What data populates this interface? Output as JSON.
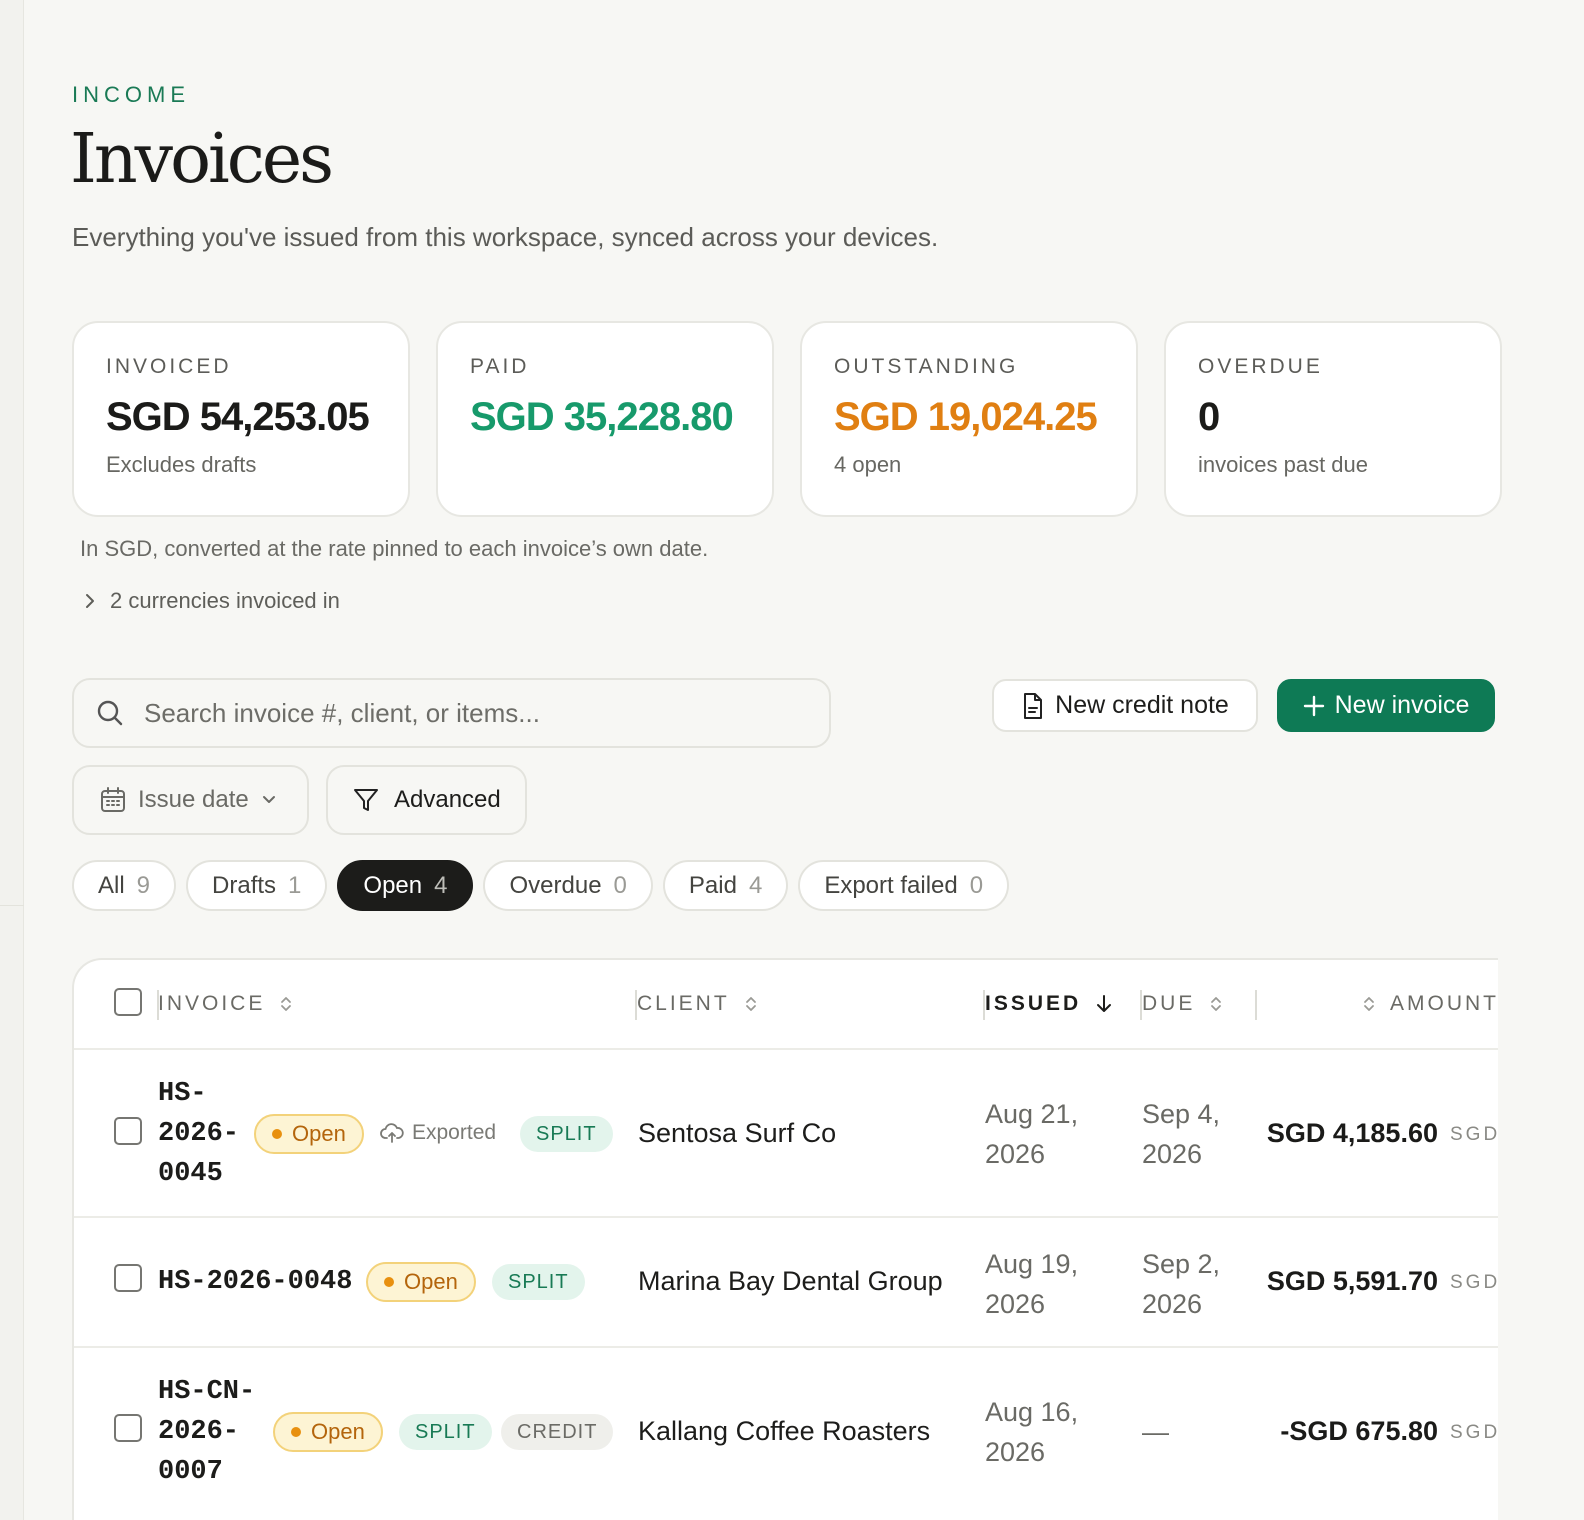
{
  "header": {
    "eyebrow": "INCOME",
    "title": "Invoices",
    "subtitle": "Everything you've issued from this workspace, synced across your devices."
  },
  "stats": [
    {
      "label": "INVOICED",
      "value": "SGD 54,253.05",
      "note": "Excludes drafts",
      "color": "#1b1b19"
    },
    {
      "label": "PAID",
      "value": "SGD 35,228.80",
      "note": "",
      "color": "#179a6b"
    },
    {
      "label": "OUTSTANDING",
      "value": "SGD 19,024.25",
      "note": "4 open",
      "color": "#e07f12"
    },
    {
      "label": "OVERDUE",
      "value": "0",
      "note": "invoices past due",
      "color": "#1b1b19"
    }
  ],
  "conversion_note": "In SGD, converted at the rate pinned to each invoice’s own date.",
  "currencies_toggle": "2 currencies invoiced in",
  "search": {
    "placeholder": "Search invoice #, client, or items..."
  },
  "actions": {
    "new_credit_note": "New credit note",
    "new_invoice": "New invoice"
  },
  "filters": {
    "issue_date": "Issue date",
    "advanced": "Advanced"
  },
  "chips": [
    {
      "label": "All",
      "count": "9",
      "active": false
    },
    {
      "label": "Drafts",
      "count": "1",
      "active": false
    },
    {
      "label": "Open",
      "count": "4",
      "active": true
    },
    {
      "label": "Overdue",
      "count": "0",
      "active": false
    },
    {
      "label": "Paid",
      "count": "4",
      "active": false
    },
    {
      "label": "Export failed",
      "count": "0",
      "active": false
    }
  ],
  "table": {
    "columns": {
      "invoice": "INVOICE",
      "client": "CLIENT",
      "issued": "ISSUED",
      "due": "DUE",
      "amount": "AMOUNT"
    },
    "rows": [
      {
        "number_lines": [
          "HS-",
          "2026-",
          "0045"
        ],
        "status": "Open",
        "exported": "Exported",
        "tags": [
          "SPLIT"
        ],
        "client": "Sentosa Surf Co",
        "issued_lines": [
          "Aug 21,",
          "2026"
        ],
        "due_lines": [
          "Sep 4,",
          "2026"
        ],
        "amount": "SGD 4,185.60",
        "currency": "SGD"
      },
      {
        "number_lines": [
          "HS-2026-0048"
        ],
        "status": "Open",
        "exported": "",
        "tags": [
          "SPLIT"
        ],
        "client": "Marina Bay Dental Group",
        "issued_lines": [
          "Aug 19,",
          "2026"
        ],
        "due_lines": [
          "Sep 2,",
          "2026"
        ],
        "amount": "SGD 5,591.70",
        "currency": "SGD"
      },
      {
        "number_lines": [
          "HS-CN-",
          "2026-",
          "0007"
        ],
        "status": "Open",
        "exported": "",
        "tags": [
          "SPLIT",
          "CREDIT"
        ],
        "client": "Kallang Coffee Roasters",
        "issued_lines": [
          "Aug 16,",
          "2026"
        ],
        "due_lines": [
          "—"
        ],
        "amount": "-SGD 675.80",
        "currency": "SGD"
      }
    ]
  }
}
